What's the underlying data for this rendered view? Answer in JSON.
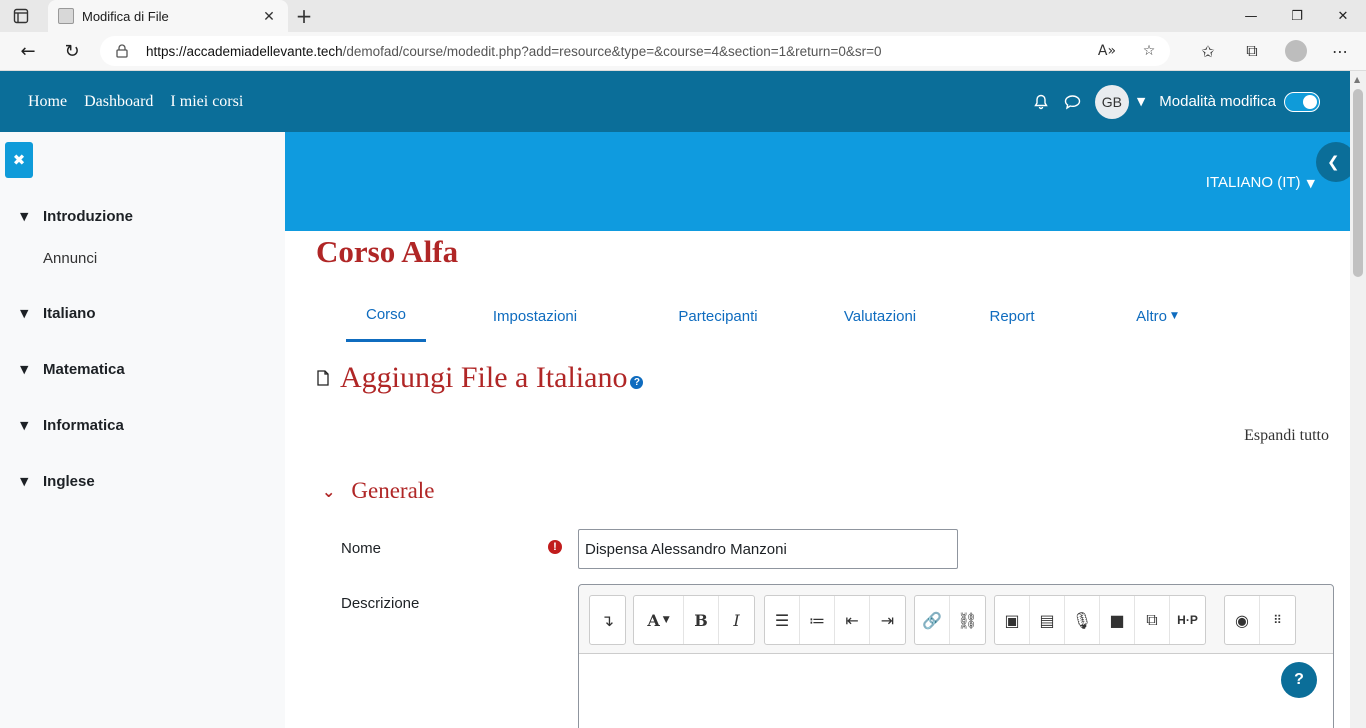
{
  "browser": {
    "tab_title": "Modifica di File",
    "tab_close": "✕",
    "new_tab": "+",
    "url_host": "https://accademiadellevante.tech",
    "url_path": "/demofad/course/modedit.php?add=resource&type=&course=4&section=1&return=0&sr=0",
    "window_controls": {
      "minimize": "—",
      "maximize": "❐",
      "close": "✕"
    }
  },
  "navbar": {
    "links": [
      "Home",
      "Dashboard",
      "I miei corsi"
    ],
    "avatar_initials": "GB",
    "edit_mode_label": "Modalità modifica",
    "edit_mode_on": true
  },
  "drawer": {
    "close_symbol": "✖",
    "sections": [
      {
        "label": "Introduzione",
        "items": [
          "Annunci"
        ]
      },
      {
        "label": "Italiano",
        "items": []
      },
      {
        "label": "Matematica",
        "items": []
      },
      {
        "label": "Informatica",
        "items": []
      },
      {
        "label": "Inglese",
        "items": []
      }
    ]
  },
  "header": {
    "language": "ITALIANO (IT)",
    "course_title": "Corso Alfa"
  },
  "tabs": [
    "Corso",
    "Impostazioni",
    "Partecipanti",
    "Valutazioni",
    "Report",
    "Altro"
  ],
  "active_tab": "Corso",
  "page": {
    "heading": "Aggiungi File a Italiano",
    "expand_all": "Espandi tutto",
    "section_title": "Generale",
    "name_label": "Nome",
    "name_value": "Dispensa Alessandro Manzoni",
    "description_label": "Descrizione",
    "help_symbol": "?"
  },
  "colors": {
    "navbar": "#0b6e99",
    "banner": "#0f9bdf",
    "heading_red": "#b02626",
    "link_blue": "#0f6cbf",
    "required_red": "#c11c1c"
  }
}
